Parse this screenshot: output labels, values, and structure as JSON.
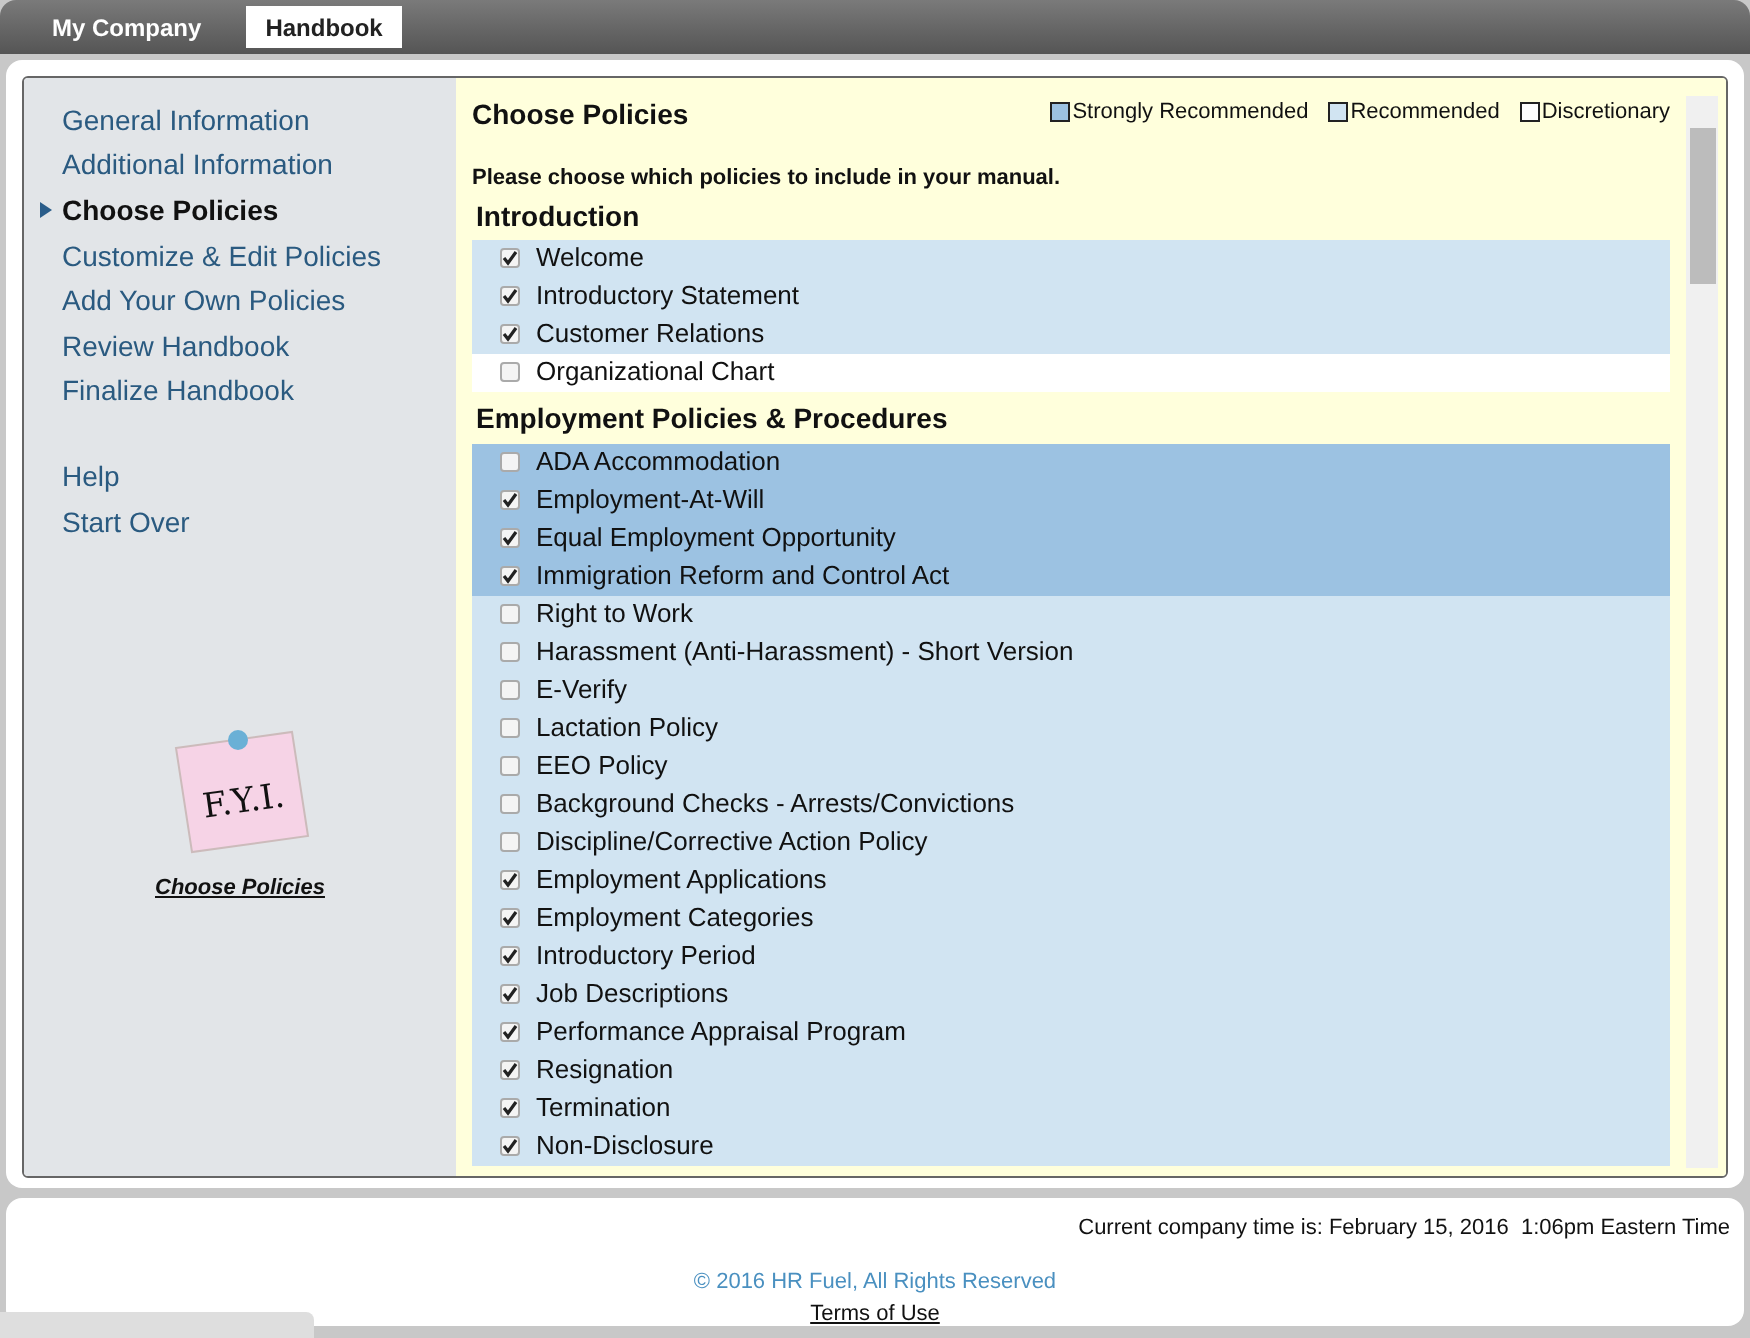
{
  "top_tabs": [
    {
      "label": "My Company",
      "selected": false
    },
    {
      "label": "Handbook",
      "selected": true
    }
  ],
  "sidebar": {
    "items": [
      {
        "label": "General Information",
        "selected": false
      },
      {
        "label": "Additional Information",
        "selected": false
      },
      {
        "label": "Choose Policies",
        "selected": true
      },
      {
        "label": "Customize & Edit Policies",
        "selected": false
      },
      {
        "label": "Add Your Own Policies",
        "selected": false
      },
      {
        "label": "Review Handbook",
        "selected": false
      },
      {
        "label": "Finalize Handbook",
        "selected": false
      }
    ],
    "extra_items": [
      {
        "label": "Help"
      },
      {
        "label": "Start Over"
      }
    ],
    "note_text": "F.Y.I.",
    "note_link": "Choose Policies"
  },
  "content": {
    "title": "Choose Policies",
    "legend": [
      {
        "label": "Strongly Recommended",
        "kind": "strong"
      },
      {
        "label": "Recommended",
        "kind": "recommended"
      },
      {
        "label": "Discretionary",
        "kind": "discretionary"
      }
    ],
    "instruction": "Please choose which policies to include in your manual.",
    "sections": [
      {
        "heading": "Introduction",
        "policies": [
          {
            "label": "Welcome",
            "checked": true,
            "kind": "recommended"
          },
          {
            "label": "Introductory Statement",
            "checked": true,
            "kind": "recommended"
          },
          {
            "label": "Customer Relations",
            "checked": true,
            "kind": "recommended"
          },
          {
            "label": "Organizational Chart",
            "checked": false,
            "kind": "discretionary"
          }
        ]
      },
      {
        "heading": "Employment Policies & Procedures",
        "policies": [
          {
            "label": "ADA Accommodation",
            "checked": false,
            "kind": "strong"
          },
          {
            "label": "Employment-At-Will",
            "checked": true,
            "kind": "strong"
          },
          {
            "label": "Equal Employment Opportunity",
            "checked": true,
            "kind": "strong"
          },
          {
            "label": "Immigration Reform and Control Act",
            "checked": true,
            "kind": "strong"
          },
          {
            "label": "Right to Work",
            "checked": false,
            "kind": "recommended"
          },
          {
            "label": "Harassment (Anti-Harassment) - Short Version",
            "checked": false,
            "kind": "recommended"
          },
          {
            "label": "E-Verify",
            "checked": false,
            "kind": "recommended"
          },
          {
            "label": "Lactation Policy",
            "checked": false,
            "kind": "recommended"
          },
          {
            "label": "EEO Policy",
            "checked": false,
            "kind": "recommended"
          },
          {
            "label": "Background Checks - Arrests/Convictions",
            "checked": false,
            "kind": "recommended"
          },
          {
            "label": "Discipline/Corrective Action Policy",
            "checked": false,
            "kind": "recommended"
          },
          {
            "label": "Employment Applications",
            "checked": true,
            "kind": "recommended"
          },
          {
            "label": "Employment Categories",
            "checked": true,
            "kind": "recommended"
          },
          {
            "label": "Introductory Period",
            "checked": true,
            "kind": "recommended"
          },
          {
            "label": "Job Descriptions",
            "checked": true,
            "kind": "recommended"
          },
          {
            "label": "Performance Appraisal Program",
            "checked": true,
            "kind": "recommended"
          },
          {
            "label": "Resignation",
            "checked": true,
            "kind": "recommended"
          },
          {
            "label": "Termination",
            "checked": true,
            "kind": "recommended"
          },
          {
            "label": "Non-Disclosure",
            "checked": true,
            "kind": "recommended"
          }
        ]
      }
    ]
  },
  "footer": {
    "time": "Current company time is: February 15, 2016  1:06pm Eastern Time",
    "copyright": "© 2016 HR Fuel, All Rights Reserved",
    "terms": "Terms of Use"
  }
}
